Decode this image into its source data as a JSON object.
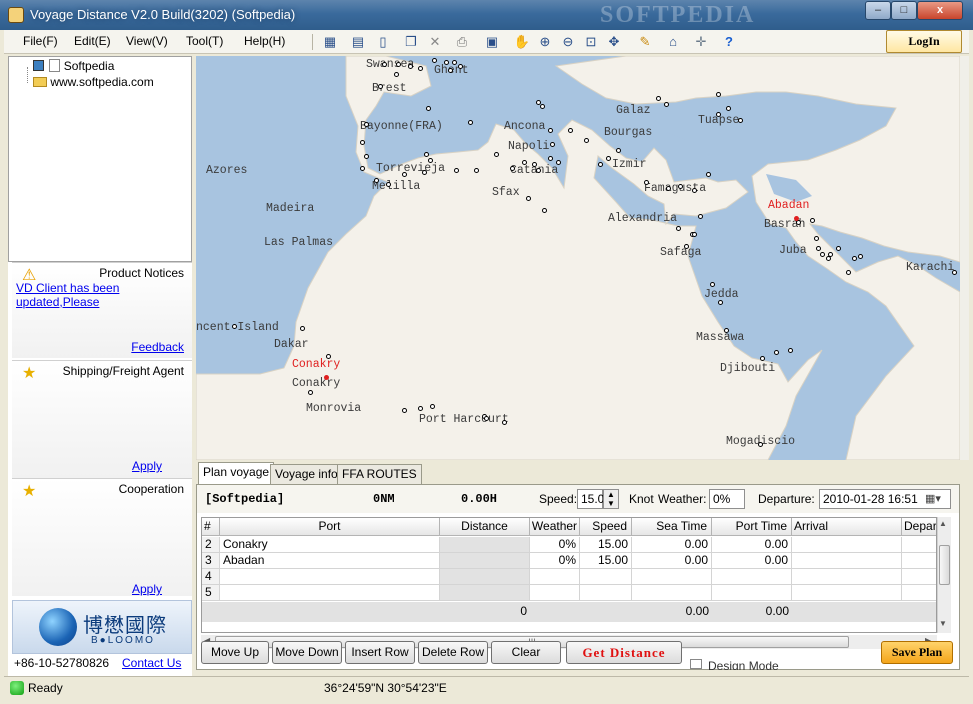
{
  "window": {
    "title": "Voyage Distance V2.0 Build(3202) (Softpedia)",
    "close": "x",
    "maximize": "□",
    "minimize": "–"
  },
  "menu": [
    "File(F)",
    "Edit(E)",
    "View(V)",
    "Tool(T)",
    "Help(H)"
  ],
  "toolbar_icons": [
    "new-route-icon",
    "notes-icon",
    "new-doc-icon",
    "copy-icon",
    "delete-icon",
    "print-icon",
    "calculator-icon",
    "pan-hand-icon",
    "zoom-in-icon",
    "zoom-out-icon",
    "zoom-fit-icon",
    "move-icon",
    "ruler-icon",
    "port-icon",
    "crosshair-icon",
    "help-icon"
  ],
  "login_label": "LogIn",
  "tree": {
    "root": "Softpedia",
    "child": "www.softpedia.com"
  },
  "panels": {
    "notices": {
      "title": "Product Notices",
      "link": "VD Client has been updated,Please",
      "action": "Feedback"
    },
    "agent": {
      "title": "Shipping/Freight Agent",
      "action": "Apply"
    },
    "cooperation": {
      "title": "Cooperation",
      "action": "Apply"
    }
  },
  "logo": {
    "cn": "博懋國際",
    "en": "B●LOOMO"
  },
  "contact": {
    "phone": "+86-10-52780826",
    "link": "Contact Us"
  },
  "watermark": "SOFTPEDIA",
  "map_labels": [
    {
      "text": "Swansea"
    },
    {
      "text": "Ghent"
    },
    {
      "text": "Brest"
    },
    {
      "text": "Bayonne(FRA)"
    },
    {
      "text": "Galaz"
    },
    {
      "text": "Tuapse"
    },
    {
      "text": "Ancona"
    },
    {
      "text": "Bourgas"
    },
    {
      "text": "Napoli"
    },
    {
      "text": "Izmir"
    },
    {
      "text": "Azores"
    },
    {
      "text": "Torrevieja"
    },
    {
      "text": "Melilla"
    },
    {
      "text": "Catania"
    },
    {
      "text": "Sfax"
    },
    {
      "text": "Famagusta"
    },
    {
      "text": "Madeira"
    },
    {
      "text": "Abadan",
      "red": true
    },
    {
      "text": "Basrah"
    },
    {
      "text": "Alexandria"
    },
    {
      "text": "Juba"
    },
    {
      "text": "Las Palmas"
    },
    {
      "text": "Safaga"
    },
    {
      "text": "Karachi"
    },
    {
      "text": "Jedda"
    },
    {
      "text": "ncent Island"
    },
    {
      "text": "Dakar"
    },
    {
      "text": "Massawa"
    },
    {
      "text": "Conakry",
      "red": true
    },
    {
      "text": "Djibouti"
    },
    {
      "text": "Conakry"
    },
    {
      "text": "Monrovia"
    },
    {
      "text": "Port Harcourt"
    },
    {
      "text": "Mogadiscio"
    }
  ],
  "tabs": [
    "Plan voyage",
    "Voyage info",
    "FFA ROUTES"
  ],
  "plan": {
    "vessel": "[Softpedia]",
    "total_distance": "0NM",
    "total_time": "0.00H",
    "speed_label": "Speed:",
    "speed_value": "15.0",
    "speed_unit": "Knot",
    "weather_label": "Weather:",
    "weather_value": "0%",
    "departure_label": "Departure:",
    "departure_value": "2010-01-28 16:51"
  },
  "grid": {
    "headers": [
      "#",
      "Port",
      "Distance",
      "Weather",
      "Speed",
      "Sea Time",
      "Port Time",
      "Arrival",
      "Depar"
    ],
    "rows": [
      [
        "2",
        "Conakry",
        "",
        "0%",
        "15.00",
        "0.00",
        "0.00",
        "",
        ""
      ],
      [
        "3",
        "Abadan",
        "",
        "0%",
        "15.00",
        "0.00",
        "0.00",
        "",
        ""
      ],
      [
        "4",
        "",
        "",
        "",
        "",
        "",
        "",
        "",
        ""
      ],
      [
        "5",
        "",
        "",
        "",
        "",
        "",
        "",
        "",
        ""
      ]
    ],
    "totals": {
      "distance": "0",
      "sea_time": "0.00",
      "port_time": "0.00"
    },
    "hscroll_grip": "III"
  },
  "buttons": {
    "move_up": "Move Up",
    "move_down": "Move Down",
    "insert_row": "Insert Row",
    "delete_row": "Delete Row",
    "clear": "Clear",
    "get_distance": "Get Distance",
    "save_plan": "Save Plan",
    "design_mode": "Design Mode"
  },
  "status": {
    "text": "Ready",
    "coords": "36°24'59\"N 30°54'23\"E"
  },
  "colors": {
    "accent": "#3a6a9c",
    "land": "#f4f1ea",
    "sea": "#a8c4e0",
    "port_highlight": "#e02020"
  }
}
